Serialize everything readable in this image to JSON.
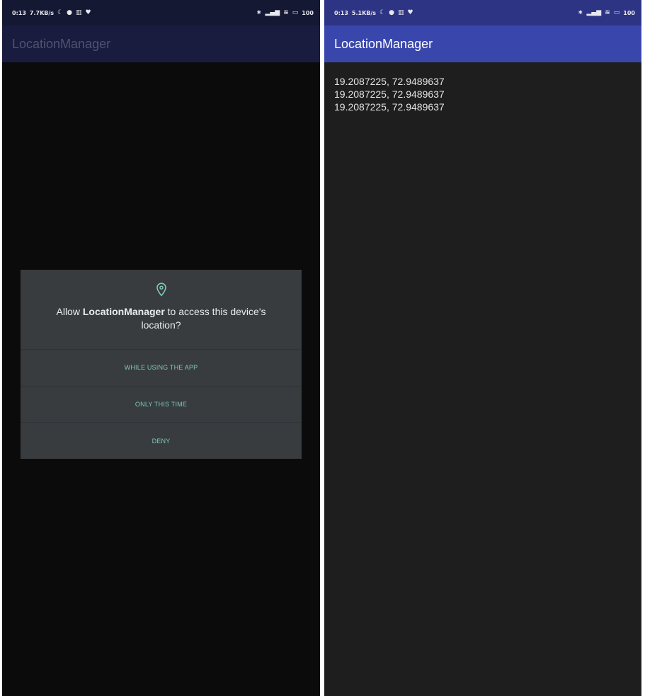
{
  "left": {
    "status": {
      "time": "0:13",
      "speed": "7.7KB/s",
      "battery": "100"
    },
    "app_title": "LocationManager",
    "dialog": {
      "title_prefix": "Allow ",
      "title_app": "LocationManager",
      "title_suffix": " to access this device's location?",
      "buttons": [
        "WHILE USING THE APP",
        "ONLY THIS TIME",
        "DENY"
      ]
    }
  },
  "right": {
    "status": {
      "time": "0:13",
      "speed": "5.1KB/s",
      "battery": "100"
    },
    "app_title": "LocationManager",
    "coordinates": [
      "19.2087225, 72.9489637",
      "19.2087225, 72.9489637",
      "19.2087225, 72.9489637"
    ]
  },
  "colors": {
    "accent_button": "#7ec8b7",
    "right_app_bar": "#3947ad",
    "left_app_bar": "#191c3f",
    "dialog_bg": "#383c3f"
  },
  "icons": {
    "status_left": [
      "moon-icon",
      "vpn-icon",
      "trash-icon",
      "heart-icon"
    ],
    "status_right": [
      "bluetooth-icon",
      "signal-icon",
      "wifi-icon",
      "battery-icon"
    ],
    "dialog": "location-pin-icon"
  }
}
